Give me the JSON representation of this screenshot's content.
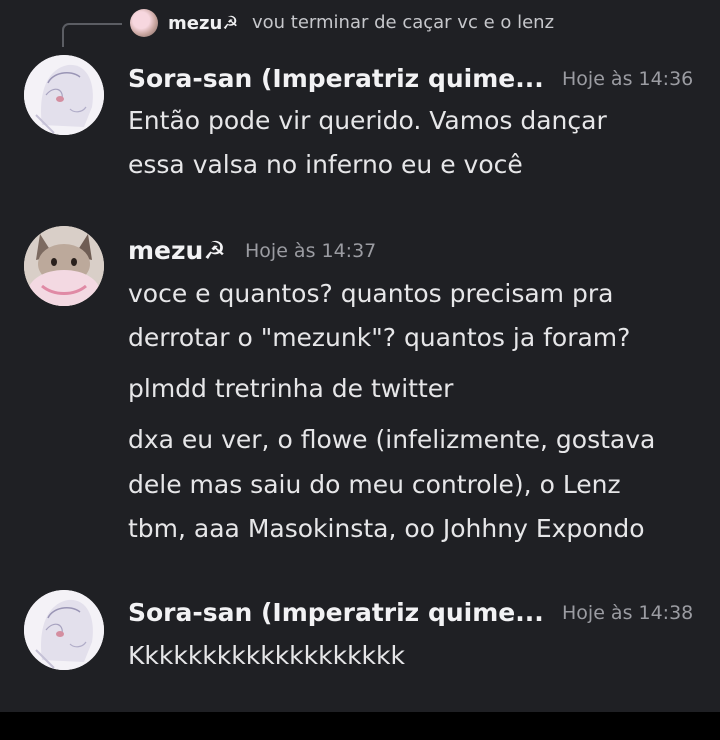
{
  "reply": {
    "author": "mezu☭",
    "text": "vou terminar de caçar vc e o lenz"
  },
  "messages": [
    {
      "author": "Sora-san (Imperatriz quime...",
      "time": "Hoje às 14:36",
      "lines": [
        "Então pode vir querido. Vamos dançar",
        "essa valsa no inferno eu e você"
      ]
    },
    {
      "author": "mezu☭",
      "time": "Hoje às 14:37",
      "lines": [
        "voce e quantos? quantos precisam pra",
        "derrotar o \"mezunk\"? quantos ja foram?",
        "plmdd tretrinha de twitter",
        "dxa eu ver, o flowe (infelizmente, gostava",
        "dele mas saiu do meu controle), o Lenz",
        "tbm, aaa Masokinsta, oo Johhny Expondo"
      ]
    },
    {
      "author": "Sora-san (Imperatriz quime...",
      "time": "Hoje às 14:38",
      "lines": [
        "Kkkkkkkkkkkkkkkkkkk"
      ]
    }
  ]
}
